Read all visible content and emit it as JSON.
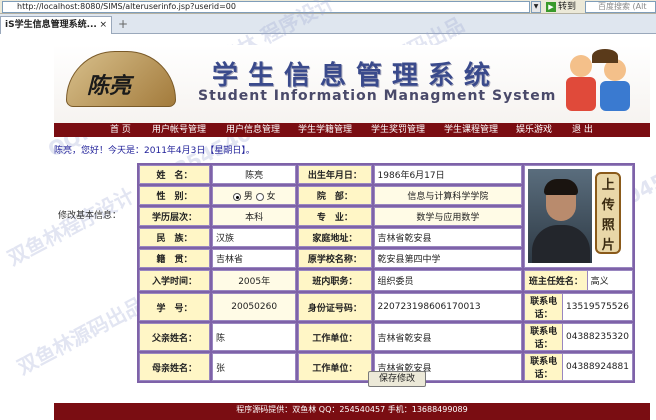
{
  "browser": {
    "url": "http://localhost:8080/SIMS/alteruserinfo.jsp?userid=00",
    "go_label": "转到",
    "search_placeholder": "百度搜索 (Alt",
    "tab_title": "iS学生信息管理系统..."
  },
  "header": {
    "logo_text": "陈亮",
    "title_cn": "学生信息管理系统",
    "title_en": "Student Information Managment System"
  },
  "nav": [
    "首 页",
    "用户帐号管理",
    "用户信息管理",
    "学生学籍管理",
    "学生奖罚管理",
    "学生课程管理",
    "娱乐游戏",
    "退 出"
  ],
  "greeting": {
    "name": "陈亮",
    "text": "，您好！今天是：2011年4月3日【星期日】。"
  },
  "side_label": "修改基本信息：",
  "form": {
    "name_label": "姓　名：",
    "name": "陈亮",
    "birth_label": "出生年月日：",
    "birth": "1986年6月17日",
    "sex_label": "性　别：",
    "sex_male": "男",
    "sex_female": "女",
    "dept_label": "院　部：",
    "dept": "信息与计算科学学院",
    "edu_label": "学历层次：",
    "edu": "本科",
    "major_label": "专　业：",
    "major": "数学与应用数学",
    "nation_label": "民　族：",
    "nation": "汉族",
    "home_label": "家庭地址：",
    "home": "吉林省乾安县",
    "origin_label": "籍　贯：",
    "origin": "吉林省",
    "school_label": "原学校名称：",
    "school": "乾安县第四中学",
    "upload_label": "上传照片",
    "enroll_label": "入学时间：",
    "enroll": "2005年",
    "post_label": "班内职务：",
    "post": "组织委员",
    "teacher_label": "班主任姓名：",
    "teacher": "高义",
    "sid_label": "学　号：",
    "sid": "20050260",
    "idcard_label": "身份证号码：",
    "idcard": "220723198606170013",
    "phone_label": "联系电话：",
    "phone": "13519575526",
    "father_label": "父亲姓名：",
    "father": "陈",
    "work1_label": "工作单位：",
    "work1": "吉林省乾安县",
    "phone2_label": "联系电话：",
    "phone2": "04388235320",
    "mother_label": "母亲姓名：",
    "mother": "张",
    "work2_label": "工作单位：",
    "work2": "吉林省乾安县",
    "phone3_label": "联系电话：",
    "phone3": "04388924881"
  },
  "save_label": "保存修改",
  "footer": "程序源码提供：双鱼林  QQ：254540457  手机：13688499089",
  "watermarks": [
    "QQ:254540457 汪建林 程序设计",
    "汪建林源码出品",
    "双鱼林程序设计 QQ:254540457",
    "汪建林程序设计 QQ:254540457",
    "双鱼林源码出品"
  ]
}
